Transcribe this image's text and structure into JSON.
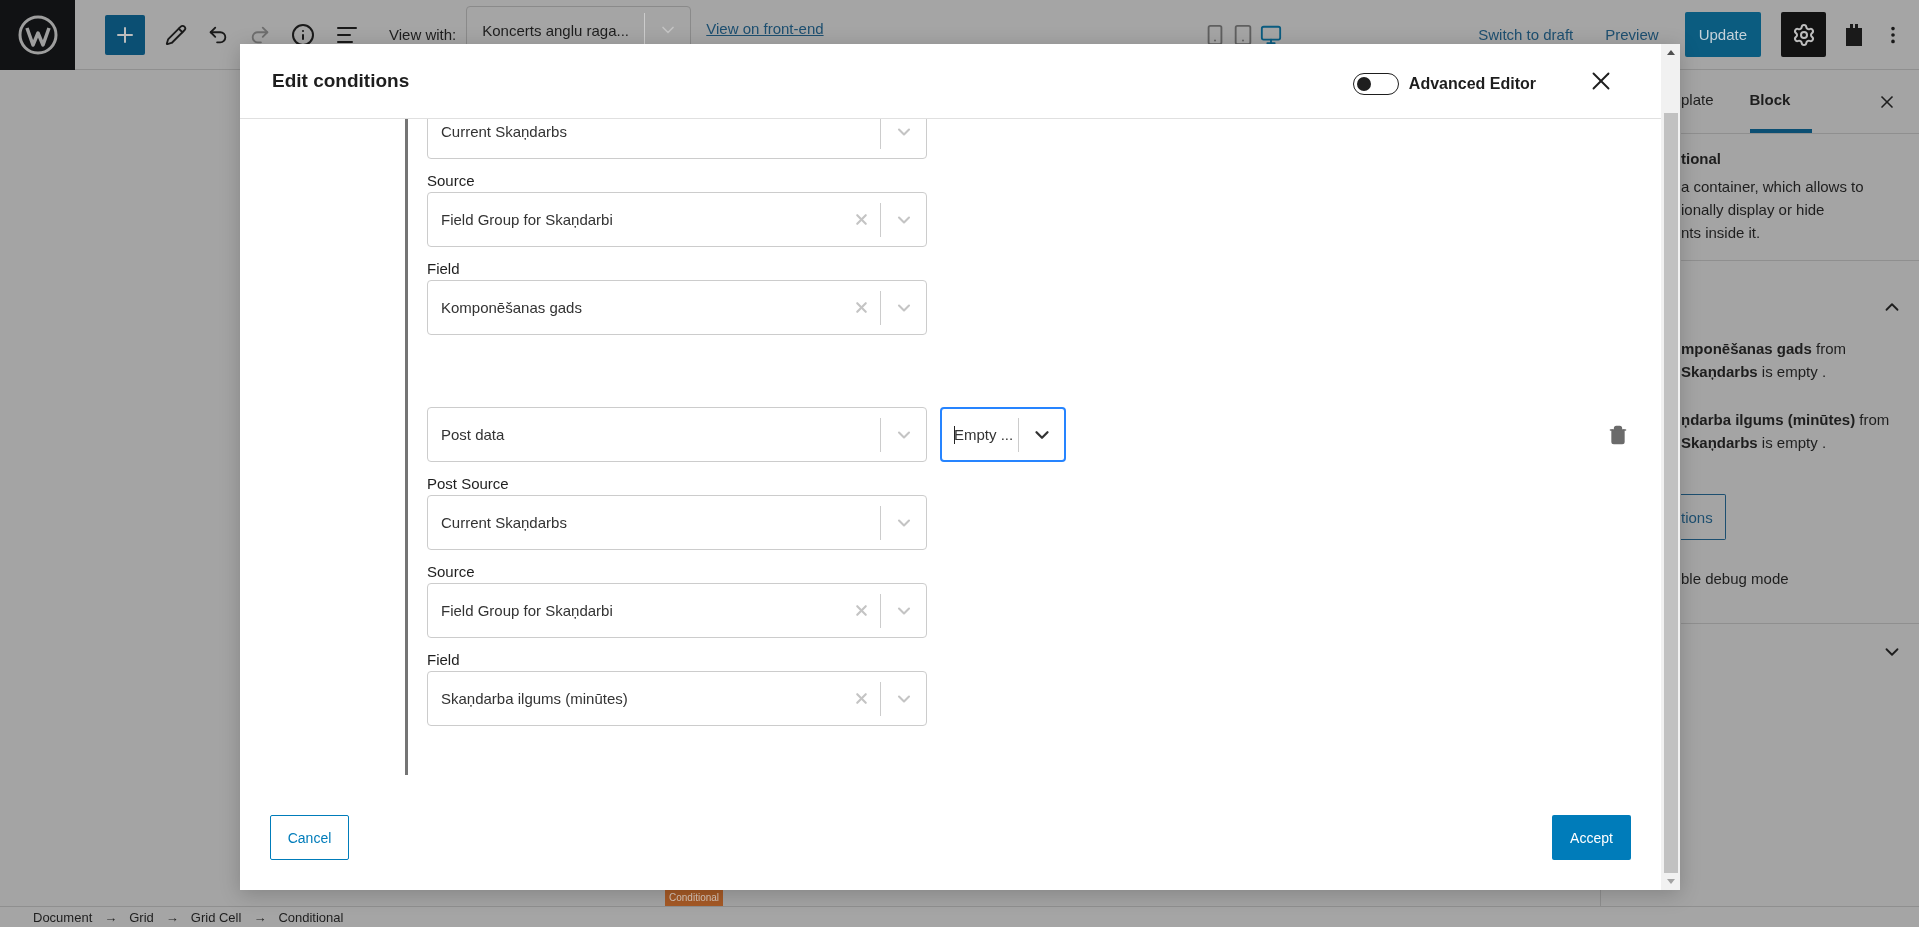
{
  "toolbar": {
    "add_active": true,
    "view_with_label": "View with:",
    "view_select": "Koncerts anglu raga...",
    "front_end_link": "View on front-end",
    "devices": [
      {
        "kind": "mobile",
        "selected": false
      },
      {
        "kind": "tablet",
        "selected": false
      },
      {
        "kind": "desktop",
        "selected": true
      }
    ],
    "switch_to_draft": "Switch to draft",
    "preview": "Preview",
    "update": "Update",
    "settings_open": true
  },
  "sidebar": {
    "tabs": [
      {
        "label": "plate",
        "selected": false
      },
      {
        "label": "Block",
        "selected": true
      }
    ],
    "block_title": "tional",
    "description": [
      "a container, which allows to",
      "ionally display or hide",
      "nts inside it."
    ],
    "conditions_panel": {
      "expanded": true,
      "summaries": [
        [
          "**mponēšanas gads** from",
          "**Skaņdarbs** is empty ."
        ],
        [
          "**ņdarba ilgums (minūtes)** from",
          "**Skaņdarbs** is empty ."
        ]
      ],
      "edit_button": "tions",
      "debug_label": "ble debug mode"
    },
    "second_panel": {
      "expanded": false
    }
  },
  "canvas_tag": "Conditional",
  "breadcrumbs": {
    "separator": "→",
    "items": [
      "Document",
      "Grid",
      "Grid Cell",
      "Conditional"
    ]
  },
  "modal": {
    "title": "Edit conditions",
    "advanced_editor": {
      "label": "Advanced Editor",
      "on": false
    },
    "conditions": [
      {
        "fields": [
          {
            "value": "Current Skaņdarbs",
            "clearable": false
          },
          {
            "label": "Source",
            "value": "Field Group for Skaņdarbi",
            "clearable": true
          },
          {
            "label": "Field",
            "value": "Komponēšanas gads",
            "clearable": true
          }
        ]
      },
      {
        "type": "Post data",
        "operator": {
          "value": "Empty ...",
          "focused": true
        },
        "fields": [
          {
            "label": "Post Source",
            "value": "Current Skaņdarbs",
            "clearable": false
          },
          {
            "label": "Source",
            "value": "Field Group for Skaņdarbi",
            "clearable": true
          },
          {
            "label": "Field",
            "value": "Skaņdarba ilgums (minūtes)",
            "clearable": true
          }
        ]
      }
    ],
    "cancel": "Cancel",
    "accept": "Accept"
  }
}
